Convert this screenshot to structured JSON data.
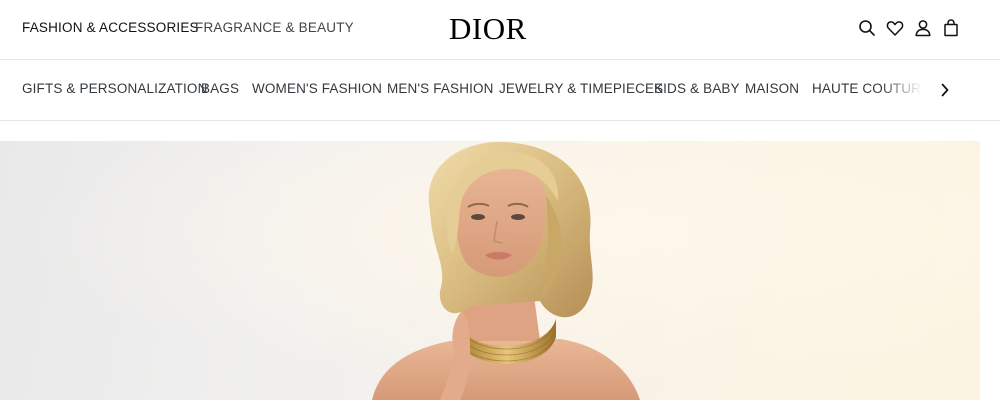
{
  "header": {
    "universes": [
      "FASHION & ACCESSORIES",
      "FRAGRANCE & BEAUTY"
    ],
    "logo": "DIOR",
    "icons": [
      "search-icon",
      "heart-icon",
      "account-icon",
      "bag-icon"
    ]
  },
  "nav": {
    "items": [
      "GIFTS & PERSONALIZATION",
      "BAGS",
      "WOMEN'S FASHION",
      "MEN'S FASHION",
      "JEWELRY & TIMEPIECES",
      "KIDS & BABY",
      "MAISON",
      "HAUTE COUTURE"
    ],
    "next_icon": "chevron-right-icon"
  },
  "hero": {
    "image": "campaign-portrait"
  }
}
